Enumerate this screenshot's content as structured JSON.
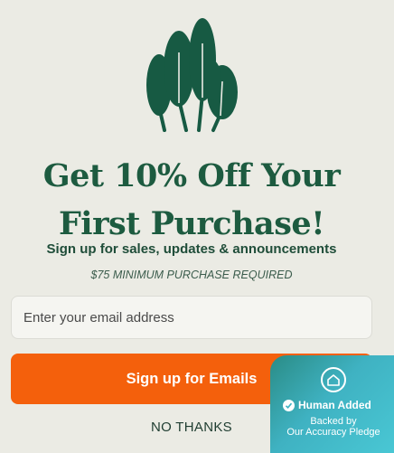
{
  "headline_line1": "Get 10% Off Your",
  "headline_line2": "First Purchase!",
  "subheadline": "Sign up for sales, updates & announcements",
  "minimum_note": "$75 MINIMUM PURCHASE REQUIRED",
  "email": {
    "placeholder": "Enter your email address",
    "value": ""
  },
  "cta_label": "Sign up for Emails",
  "dismiss_label": "NO THANKS",
  "badge": {
    "title": "Human Added",
    "line1": "Backed by",
    "line2": "Our Accuracy Pledge"
  },
  "colors": {
    "brand_green": "#1d5b40",
    "cta_orange": "#f4600c",
    "background": "#ebebe4",
    "badge_teal": "#3fb2c2"
  },
  "icons": [
    "trees-logo-icon",
    "house-icon",
    "check-circle-icon"
  ]
}
